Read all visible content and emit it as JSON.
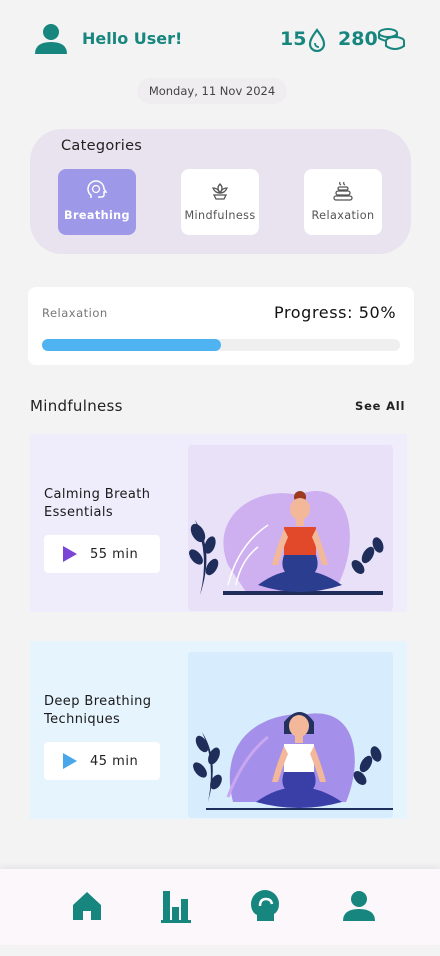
{
  "header": {
    "greeting": "Hello User!",
    "streak": "15",
    "coins": "280",
    "icons": {
      "avatar": "user-icon",
      "streak": "drop-icon",
      "coins": "coins-icon"
    }
  },
  "date": "Monday, 11 Nov 2024",
  "categories": {
    "title": "Categories",
    "items": [
      {
        "label": "Breathing",
        "icon": "brain-head-icon",
        "selected": true
      },
      {
        "label": "Mindfulness",
        "icon": "lotus-icon",
        "selected": false
      },
      {
        "label": "Relaxation",
        "icon": "stones-icon",
        "selected": false
      }
    ]
  },
  "progress": {
    "label": "Relaxation",
    "text": "Progress: 50%",
    "value": 0.5
  },
  "section": {
    "title": "Mindfulness",
    "see_all": "See All"
  },
  "sessions": [
    {
      "title": "Calming Breath\nEssentials",
      "duration": "55 min"
    },
    {
      "title": "Deep Breathing\nTechniques",
      "duration": "45 min"
    }
  ],
  "nav": [
    "home-icon",
    "stats-icon",
    "mind-icon",
    "profile-icon"
  ],
  "colors": {
    "accent": "#17867e",
    "selected_category": "#9d99e8",
    "progress": "#4eb3f0"
  }
}
